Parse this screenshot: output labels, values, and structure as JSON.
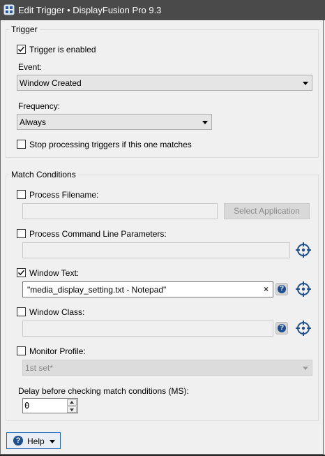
{
  "window": {
    "title": "Edit Trigger • DisplayFusion Pro 9.3"
  },
  "trigger_group": {
    "legend": "Trigger",
    "enabled": {
      "label": "Trigger is enabled",
      "checked": true
    },
    "event": {
      "label": "Event:",
      "value": "Window Created"
    },
    "frequency": {
      "label": "Frequency:",
      "value": "Always"
    },
    "stop_processing": {
      "label": "Stop processing triggers if this one matches",
      "checked": false
    }
  },
  "match_group": {
    "legend": "Match Conditions",
    "process_filename": {
      "label": "Process Filename:",
      "checked": false,
      "value": "",
      "button": "Select Application"
    },
    "command_line": {
      "label": "Process Command Line Parameters:",
      "checked": false,
      "value": ""
    },
    "window_text": {
      "label": "Window Text:",
      "checked": true,
      "value": "\"media_display_setting.txt - Notepad\"",
      "clear": "×"
    },
    "window_class": {
      "label": "Window Class:",
      "checked": false,
      "value": ""
    },
    "monitor_profile": {
      "label": "Monitor Profile:",
      "checked": false,
      "value": "1st set*"
    },
    "delay": {
      "label": "Delay before checking match conditions (MS):",
      "value": "0"
    }
  },
  "footer": {
    "help_label": "Help"
  },
  "colors": {
    "titlebar": "#4a4a4a",
    "help_accent": "#1f4f8f",
    "target_icon": "#1f4f8f"
  }
}
